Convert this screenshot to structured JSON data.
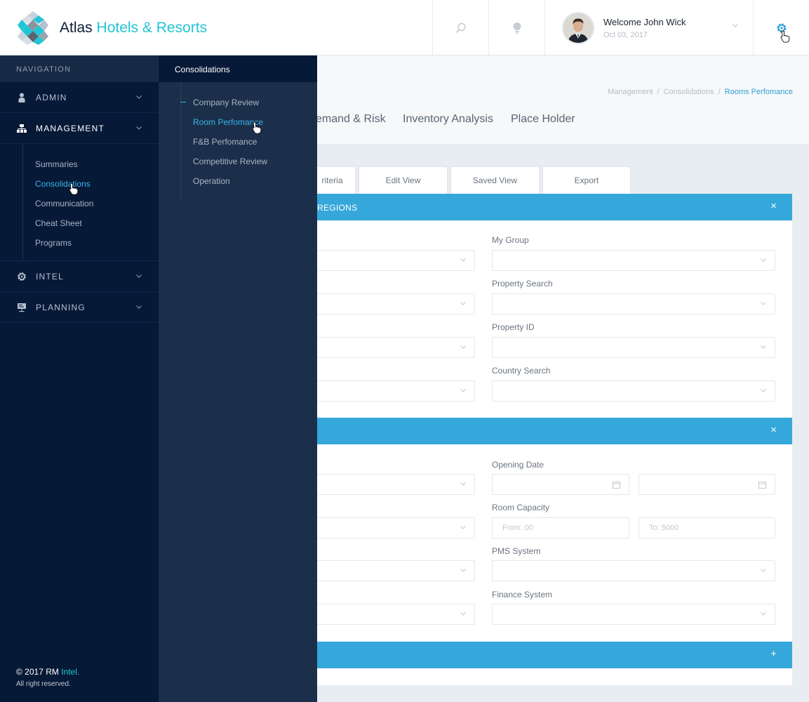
{
  "header": {
    "brand_name": "Atlas",
    "brand_accent": "Hotels & Resorts",
    "search_icon": "search-icon",
    "notification_icon": "lightbulb-icon",
    "settings_icon": "gear-icon",
    "user": {
      "welcome": "Welcome John Wick",
      "date": "Oct 03, 2017"
    }
  },
  "sidebar": {
    "heading": "NAVIGATION",
    "items": [
      {
        "label": "ADMIN",
        "icon": "user-icon"
      },
      {
        "label": "MANAGEMENT",
        "icon": "hierarchy-icon"
      },
      {
        "label": "INTEL",
        "icon": "gear-icon"
      },
      {
        "label": "PLANNING",
        "icon": "presentation-icon"
      }
    ],
    "management_sub": [
      "Summaries",
      "Consolidations",
      "Communication",
      "Cheat Sheet",
      "Programs"
    ],
    "active_sub": "Consolidations",
    "footer": {
      "copyright": "© 2017 RM",
      "accent": "Intel.",
      "rights": "All right reserved."
    }
  },
  "flyout": {
    "heading": "Consolidations",
    "items": [
      "Company Review",
      "Room Perfomance",
      "F&B Perfomance",
      "Competitive Review",
      "Operation"
    ],
    "active": "Room Perfomance"
  },
  "breadcrumb": {
    "items": [
      "Management",
      "Consolidations"
    ],
    "current": "Rooms Perfomance"
  },
  "tabs": [
    "emand & Risk",
    "Inventory Analysis",
    "Place Holder"
  ],
  "toolbar": [
    "riteria",
    "Edit View",
    "Saved View",
    "Export"
  ],
  "panels": {
    "regions": {
      "title": "REGIONS",
      "action": "×",
      "fields": [
        {
          "label": "My Group"
        },
        {
          "label": "Property Search"
        },
        {
          "label": "Property ID"
        },
        {
          "label": "Country Search"
        }
      ]
    },
    "details": {
      "title": "",
      "action": "×",
      "opening_date_label": "Opening Date",
      "room_capacity_label": "Room Capacity",
      "room_capacity_from_placeholder": "From: 00",
      "room_capacity_to_placeholder": "To: 5000",
      "pms_label": "PMS System",
      "finance_label": "Finance System"
    },
    "collapsed": {
      "title": "",
      "action": "+"
    }
  },
  "colors": {
    "accent_cyan": "#22c5d6",
    "link_blue": "#39b3e8",
    "panel_blue": "#36a7da",
    "sidebar_bg": "#061937",
    "flyout_bg": "#1b2f4a"
  }
}
